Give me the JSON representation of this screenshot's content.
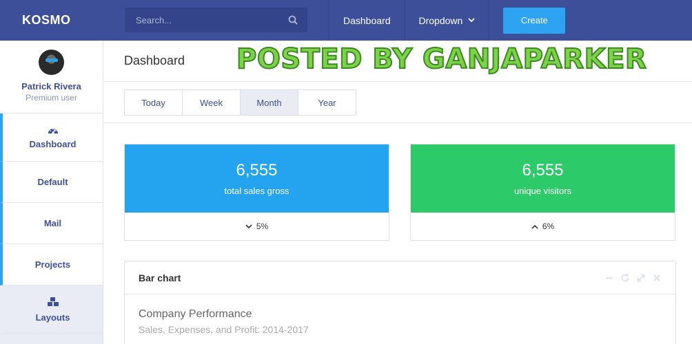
{
  "app": {
    "brand": "KOSMO"
  },
  "topbar": {
    "search_placeholder": "Search...",
    "nav": [
      {
        "label": "Dashboard"
      },
      {
        "label": "Dropdown"
      }
    ],
    "create_label": "Create"
  },
  "sidebar": {
    "profile": {
      "name": "Patrick Rivera",
      "role": "Premium user"
    },
    "items": [
      {
        "label": "Dashboard",
        "icon": "dashboard-gauge-icon"
      },
      {
        "label": "Default"
      },
      {
        "label": "Mail"
      },
      {
        "label": "Projects"
      },
      {
        "label": "Layouts",
        "icon": "cubes-icon"
      }
    ]
  },
  "page": {
    "title": "Dashboard"
  },
  "watermark": "POSTED BY GANJAPARKER",
  "tabs": [
    {
      "label": "Today"
    },
    {
      "label": "Week"
    },
    {
      "label": "Month",
      "active": true
    },
    {
      "label": "Year"
    }
  ],
  "stats": [
    {
      "value": "6,555",
      "label": "total sales gross",
      "trend": "5%",
      "trend_dir": "down",
      "color": "#24a3ef"
    },
    {
      "value": "6,555",
      "label": "unique visitors",
      "trend": "6%",
      "trend_dir": "up",
      "color": "#2dca6a"
    }
  ],
  "panel": {
    "title": "Bar chart",
    "chart_title": "Company Performance",
    "chart_subtitle": "Sales, Expenses, and Profit: 2014-2017"
  },
  "colors": {
    "topbar": "#3e4f99",
    "accent": "#2ea3f2",
    "blue": "#24a3ef",
    "green": "#2dca6a"
  }
}
